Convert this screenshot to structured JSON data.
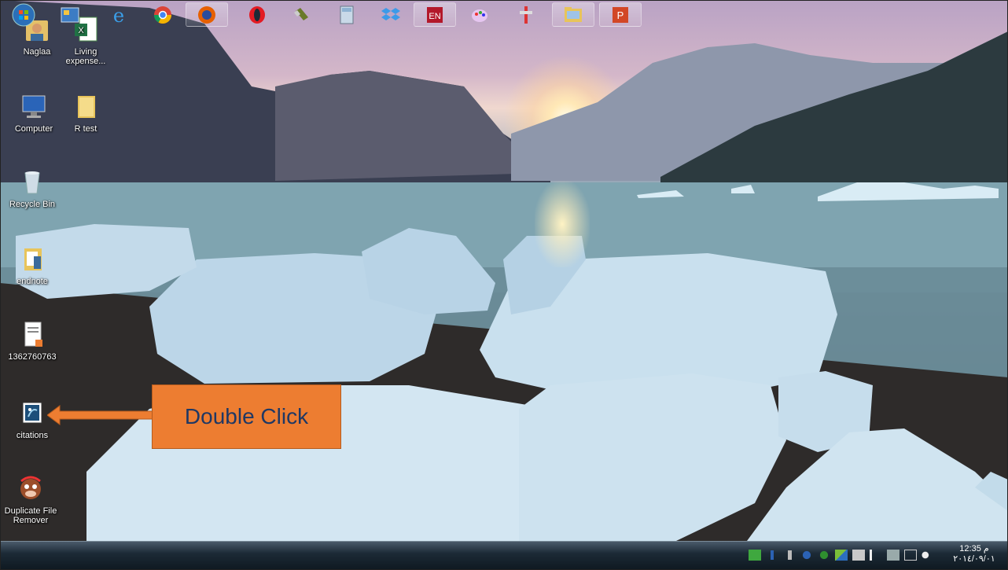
{
  "desktop": {
    "icons": [
      {
        "label": "Naglaa"
      },
      {
        "label": "Living expense..."
      },
      {
        "label": "Computer"
      },
      {
        "label": "R test"
      },
      {
        "label": "Recycle Bin"
      },
      {
        "label": "endnote"
      },
      {
        "label": "1362760763"
      },
      {
        "label": "citations"
      },
      {
        "label": "Duplicate File Remover"
      }
    ]
  },
  "callout": {
    "text": "Double Click"
  },
  "taskbar": {
    "clock_time": "12:35 م",
    "clock_date": "٢٠١٤/٠٩/٠١",
    "pinned": [
      "start-orb-icon",
      "explorer-icon",
      "internet-explorer-icon",
      "chrome-icon",
      "firefox-icon",
      "opera-icon",
      "usb-icon",
      "calculator-icon",
      "dropbox-icon",
      "endnote-icon",
      "paint-icon",
      "tool-icon",
      "folder-icon",
      "powerpoint-icon"
    ]
  },
  "colors": {
    "callout_fill": "#ed7d31",
    "callout_text": "#1f3864",
    "arrow": "#ed7d31"
  }
}
